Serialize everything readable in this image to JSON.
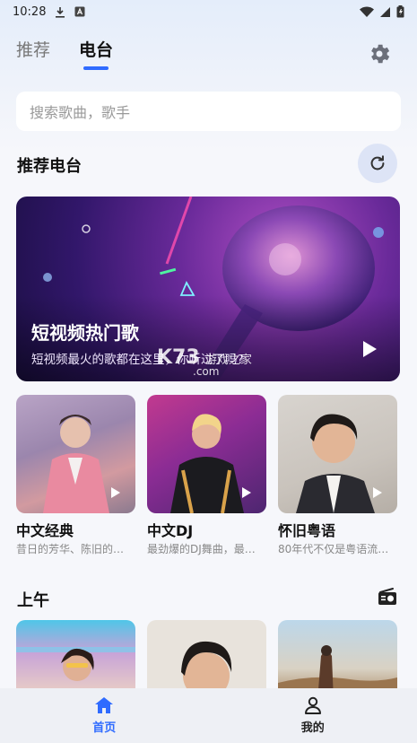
{
  "status_bar": {
    "time": "10:28",
    "icons": [
      "download-icon",
      "a-badge-icon",
      "wifi-icon",
      "signal-icon",
      "battery-icon"
    ]
  },
  "tabs": [
    {
      "label": "推荐",
      "active": false
    },
    {
      "label": "电台",
      "active": true
    }
  ],
  "search": {
    "placeholder": "搜索歌曲，歌手"
  },
  "recommended": {
    "title": "推荐电台",
    "banner": {
      "title": "短视频热门歌",
      "subtitle": "短视频最火的歌都在这里，你听过了吗?"
    },
    "cards": [
      {
        "title": "中文经典",
        "desc": "昔日的芳华、陈旧的…"
      },
      {
        "title": "中文DJ",
        "desc": "最劲爆的DJ舞曲，最…"
      },
      {
        "title": "怀旧粤语",
        "desc": "80年代不仅是粤语流…"
      }
    ]
  },
  "watermark": {
    "line1": "K73",
    "line2": "游戏之家",
    "line3": ".com"
  },
  "morning": {
    "title": "上午"
  },
  "bottom_nav": [
    {
      "label": "首页",
      "active": true
    },
    {
      "label": "我的",
      "active": false
    }
  ],
  "colors": {
    "accent": "#2f6bff",
    "background": "#f6f7fb",
    "nav_background": "#eef0f5"
  }
}
